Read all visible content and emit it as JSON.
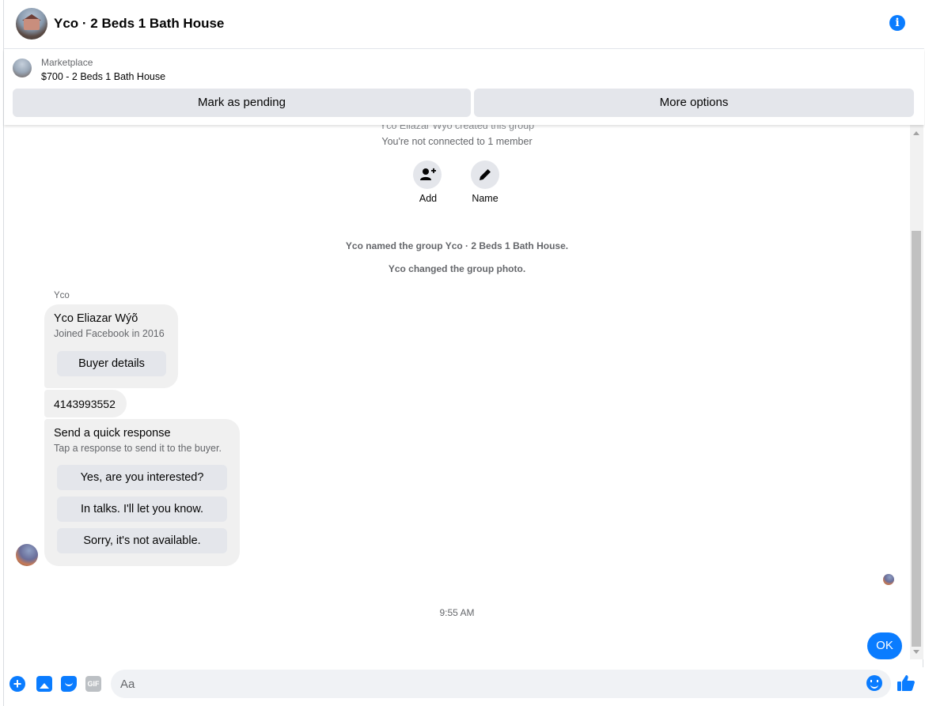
{
  "header": {
    "title": "Yco · 2 Beds 1 Bath House",
    "info_icon": "info-icon"
  },
  "marketplace": {
    "label": "Marketplace",
    "listing": "$700 - 2 Beds 1 Bath House",
    "pending_button": "Mark as pending",
    "more_button": "More options"
  },
  "chat": {
    "created": "Yco Eliazar Wýõ created this group",
    "not_connected": "You're not connected to 1 member",
    "actions": [
      {
        "label": "Add",
        "icon": "add-person-icon"
      },
      {
        "label": "Name",
        "icon": "pencil-icon"
      }
    ],
    "named_event": "Yco named the group Yco · 2 Beds 1 Bath House.",
    "photo_event": "Yco changed the group photo.",
    "sender": "Yco",
    "profile_card": {
      "name": "Yco Eliazar Wýõ",
      "joined": "Joined Facebook in 2016",
      "button": "Buyer details"
    },
    "phone_message": "4143993552",
    "quick_response": {
      "title": "Send a quick response",
      "subtitle": "Tap a response to send it to the buyer.",
      "options": [
        "Yes, are you interested?",
        "In talks. I'll let you know.",
        "Sorry, it's not available."
      ]
    },
    "timestamp": "9:55 AM",
    "my_message": "OK"
  },
  "composer": {
    "placeholder": "Aa",
    "icons": [
      "plus-icon",
      "photo-icon",
      "sticker-icon",
      "gif-icon",
      "emoji-icon",
      "like-icon"
    ],
    "gif_label": "GIF"
  },
  "colors": {
    "accent": "#0a7cff",
    "bubble": "#f0f0f0",
    "button": "#e4e6eb",
    "muted_text": "#65676b"
  }
}
